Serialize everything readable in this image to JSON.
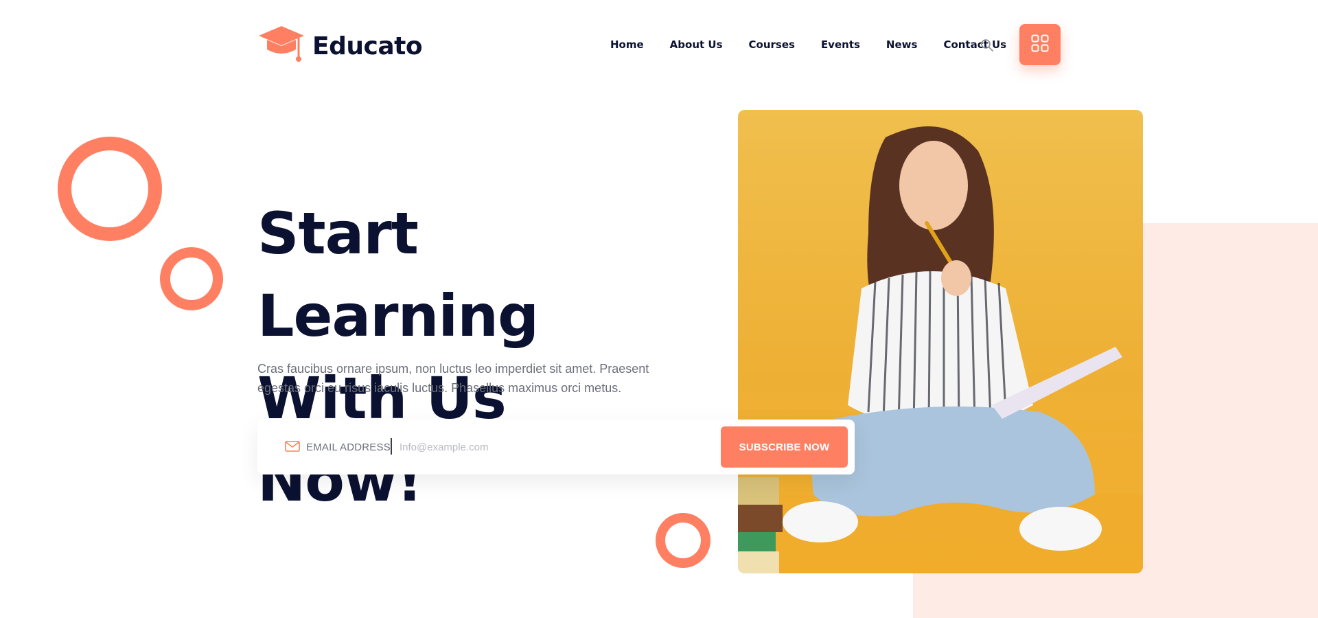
{
  "brand": {
    "name": "Educato",
    "accent": "#ff7f62",
    "dark": "#0b1130"
  },
  "nav": {
    "items": [
      "Home",
      "About Us",
      "Courses",
      "Events",
      "News",
      "Contact Us"
    ]
  },
  "icons": {
    "search": "search-icon",
    "menu": "grid-menu-icon",
    "mail": "mail-icon",
    "logo": "graduation-cap-icon"
  },
  "hero": {
    "title_line1": "Start Learning",
    "title_line2": "With Us Now!",
    "description": "Cras faucibus ornare ipsum, non luctus leo imperdiet sit amet. Praesent egestas orci eu risus iaculis luctus. Phasellus maximus orci metus."
  },
  "subscribe": {
    "label": "EMAIL ADDRESS",
    "placeholder": "Info@example.com",
    "button": "SUBSCRIBE NOW"
  }
}
